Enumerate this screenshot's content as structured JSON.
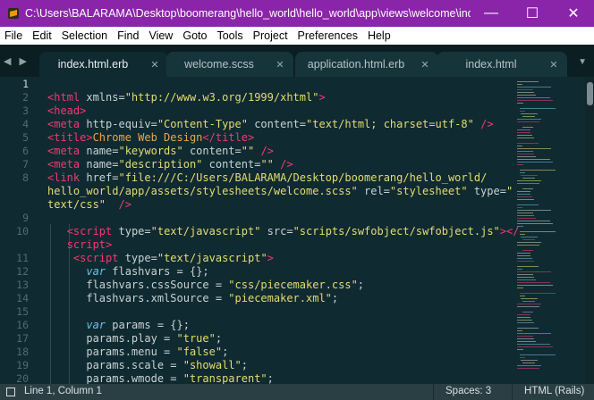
{
  "window": {
    "title": "C:\\Users\\BALARAMA\\Desktop\\boomerang\\hello_world\\hello_world\\app\\views\\welcome\\ind...",
    "minimize_glyph": "—",
    "maximize_glyph": "☐",
    "close_glyph": "✕",
    "accent_color": "#8a24a8"
  },
  "menu": {
    "items": [
      "File",
      "Edit",
      "Selection",
      "Find",
      "View",
      "Goto",
      "Tools",
      "Project",
      "Preferences",
      "Help"
    ]
  },
  "tabs": {
    "nav_glyph": "◀ ▶",
    "dropdown_glyph": "▼",
    "close_glyph": "✕",
    "items": [
      {
        "label": "index.html.erb",
        "active": true
      },
      {
        "label": "welcome.scss",
        "active": false
      },
      {
        "label": "application.html.erb",
        "active": false
      },
      {
        "label": "index.html",
        "active": false
      }
    ]
  },
  "editor": {
    "line_numbers": [
      "1",
      "2",
      "3",
      "4",
      "5",
      "6",
      "7",
      "8",
      "",
      "",
      "9",
      "10",
      "",
      "11",
      "12",
      "13",
      "14",
      "15",
      "16",
      "17",
      "18",
      "19",
      "20"
    ],
    "current_line": "1",
    "lines": [
      [],
      [
        [
          "tag",
          "<html"
        ],
        [
          "attr",
          " xmlns="
        ],
        [
          "str",
          "\"http://www.w3.org/1999/xhtml\""
        ],
        [
          "tag",
          ">"
        ]
      ],
      [
        [
          "tag",
          "<head>"
        ]
      ],
      [
        [
          "tag",
          "<meta"
        ],
        [
          "attr",
          " http-equiv="
        ],
        [
          "str",
          "\"Content-Type\""
        ],
        [
          "attr",
          " content="
        ],
        [
          "str",
          "\"text/html; charset=utf-8\""
        ],
        [
          "attr",
          " "
        ],
        [
          "tag",
          "/>"
        ]
      ],
      [
        [
          "tag",
          "<title>"
        ],
        [
          "text",
          "Chrome Web Design"
        ],
        [
          "tag",
          "</title>"
        ]
      ],
      [
        [
          "tag",
          "<meta"
        ],
        [
          "attr",
          " name="
        ],
        [
          "str",
          "\"keywords\""
        ],
        [
          "attr",
          " content="
        ],
        [
          "str",
          "\"\""
        ],
        [
          "attr",
          " "
        ],
        [
          "tag",
          "/>"
        ]
      ],
      [
        [
          "tag",
          "<meta"
        ],
        [
          "attr",
          " name="
        ],
        [
          "str",
          "\"description\""
        ],
        [
          "attr",
          " content="
        ],
        [
          "str",
          "\"\""
        ],
        [
          "attr",
          " "
        ],
        [
          "tag",
          "/>"
        ]
      ],
      [
        [
          "tag",
          "<link"
        ],
        [
          "attr",
          " href="
        ],
        [
          "str",
          "\"file:///C:/Users/BALARAMA/Desktop/boomerang/hello_world/"
        ]
      ],
      [
        [
          "str",
          "hello_world/app/assets/stylesheets/welcome.scss\""
        ],
        [
          "attr",
          " rel="
        ],
        [
          "str",
          "\"stylesheet\""
        ],
        [
          "attr",
          " type="
        ],
        [
          "str",
          "\""
        ]
      ],
      [
        [
          "str",
          "text/css\""
        ],
        [
          "attr",
          "  "
        ],
        [
          "tag",
          "/>"
        ]
      ],
      [],
      [
        [
          "attr",
          "   "
        ],
        [
          "tag",
          "<script"
        ],
        [
          "attr",
          " type="
        ],
        [
          "str",
          "\"text/javascript\""
        ],
        [
          "attr",
          " src="
        ],
        [
          "str",
          "\"scripts/swfobject/swfobject.js\""
        ],
        [
          "tag",
          "></"
        ]
      ],
      [
        [
          "attr",
          "   "
        ],
        [
          "tag",
          "script>"
        ]
      ],
      [
        [
          "attr",
          "    "
        ],
        [
          "tag",
          "<script"
        ],
        [
          "attr",
          " type="
        ],
        [
          "str",
          "\"text/javascript\""
        ],
        [
          "tag",
          ">"
        ]
      ],
      [
        [
          "attr",
          "      "
        ],
        [
          "kw",
          "var"
        ],
        [
          "attr",
          " flashvars = {};"
        ]
      ],
      [
        [
          "attr",
          "      flashvars.cssSource = "
        ],
        [
          "str",
          "\"css/piecemaker.css\""
        ],
        [
          "attr",
          ";"
        ]
      ],
      [
        [
          "attr",
          "      flashvars.xmlSource = "
        ],
        [
          "str",
          "\"piecemaker.xml\""
        ],
        [
          "attr",
          ";"
        ]
      ],
      [],
      [
        [
          "attr",
          "      "
        ],
        [
          "kw",
          "var"
        ],
        [
          "attr",
          " params = {};"
        ]
      ],
      [
        [
          "attr",
          "      params.play = "
        ],
        [
          "str",
          "\"true\""
        ],
        [
          "attr",
          ";"
        ]
      ],
      [
        [
          "attr",
          "      params.menu = "
        ],
        [
          "str",
          "\"false\""
        ],
        [
          "attr",
          ";"
        ]
      ],
      [
        [
          "attr",
          "      params.scale = "
        ],
        [
          "str",
          "\"showall\""
        ],
        [
          "attr",
          ";"
        ]
      ],
      [
        [
          "attr",
          "      params.wmode = "
        ],
        [
          "str",
          "\"transparent\""
        ],
        [
          "attr",
          ";"
        ]
      ]
    ]
  },
  "status": {
    "position": "Line 1, Column 1",
    "spaces": "Spaces: 3",
    "syntax": "HTML (Rails)"
  }
}
